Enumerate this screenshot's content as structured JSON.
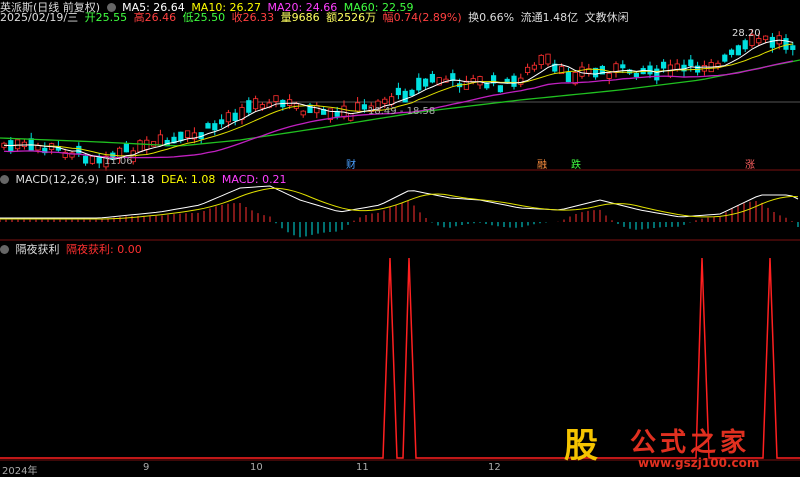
{
  "header": {
    "stock_name": "英派斯(日线 前复权)",
    "ma5": "MA5: 26.64",
    "ma10": "MA10: 26.27",
    "ma20": "MA20: 24.66",
    "ma60": "MA60: 22.59",
    "date": "2025/02/19/三",
    "open": "开25.55",
    "high": "高26.46",
    "low": "低25.50",
    "close": "收26.33",
    "volume": "量9686",
    "amount": "额2526万",
    "change": "幅0.74(2.89%)",
    "turnover": "换0.66%",
    "float": "流通1.48亿",
    "industry": "文教休闲"
  },
  "price_annotations": {
    "high_label": "28.20",
    "range_label": "18.49 - 18.58",
    "low_label": "11.06"
  },
  "event_markers": {
    "m1": "财",
    "m2": "融",
    "m3": "跌",
    "m4": "涨"
  },
  "macd": {
    "title": "MACD(12,26,9)",
    "dif": "DIF: 1.18",
    "dea": "DEA: 1.08",
    "macd": "MACD: 0.21"
  },
  "indicator": {
    "title": "隔夜获利",
    "value": "隔夜获利: 0.00"
  },
  "x_axis": {
    "labels": [
      "2024年",
      "9",
      "10",
      "11",
      "12"
    ]
  },
  "watermark": {
    "glyph": "股",
    "brand": "公式之家",
    "url": "www.gszj100.com"
  },
  "colors": {
    "ma5": "#ffffff",
    "ma10": "#ffff00",
    "ma20": "#ff00ff",
    "ma60": "#00ff00",
    "up": "#ff3030",
    "down": "#00ffff",
    "indicator_line": "#ff2020"
  }
}
